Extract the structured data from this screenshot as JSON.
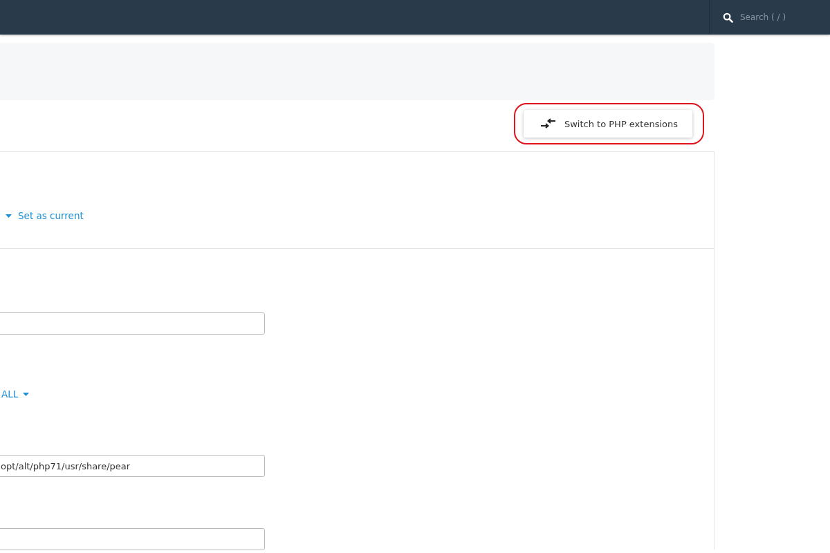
{
  "top_bar": {
    "search": {
      "placeholder": "Search ( / )"
    }
  },
  "switch_button": {
    "label": "Switch to PHP extensions",
    "highlighted": true
  },
  "version_row": {
    "action": "Set as current"
  },
  "options": [
    {
      "kind": "input"
    },
    {
      "kind": "dropdown",
      "value": "ALL"
    },
    {
      "kind": "input",
      "value": "opt/alt/php71/usr/share/pear"
    },
    {
      "kind": "input"
    }
  ]
}
